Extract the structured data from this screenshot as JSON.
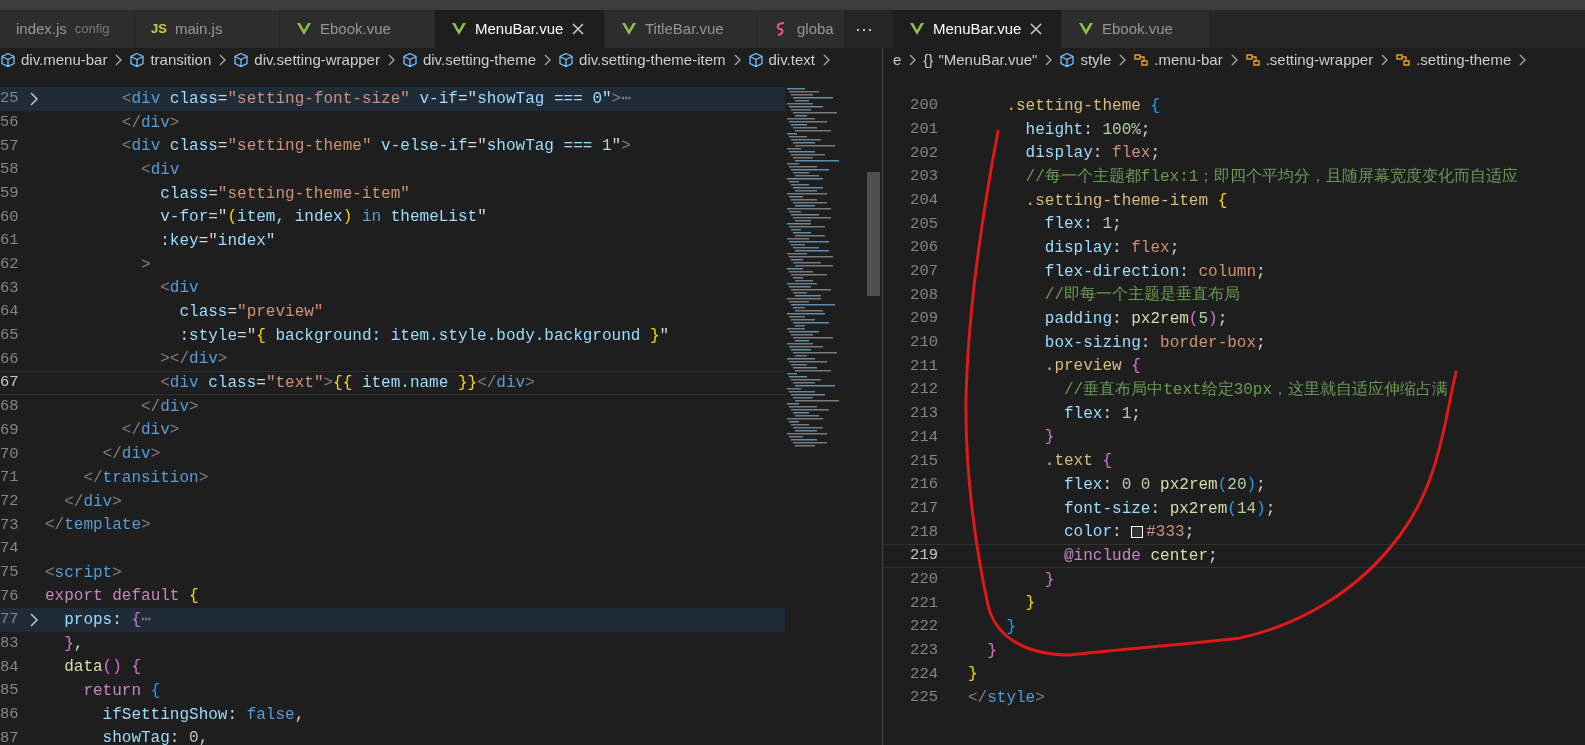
{
  "left_group": {
    "tabs": [
      {
        "label": "index.js",
        "description": "config",
        "kind": "plain",
        "selected": false
      },
      {
        "label": "main.js",
        "kind": "js",
        "badge": "JS",
        "selected": false
      },
      {
        "label": "Ebook.vue",
        "kind": "vue",
        "selected": false
      },
      {
        "label": "MenuBar.vue",
        "kind": "vue",
        "selected": true
      },
      {
        "label": "TitleBar.vue",
        "kind": "vue",
        "selected": false
      },
      {
        "label": "globa",
        "kind": "sass",
        "selected": false
      }
    ],
    "more_button": "⋯",
    "breadcrumbs": [
      {
        "label": "div.menu-bar",
        "kind": "element"
      },
      {
        "label": "transition",
        "kind": "element"
      },
      {
        "label": "div.setting-wrapper",
        "kind": "element"
      },
      {
        "label": "div.setting-theme",
        "kind": "element"
      },
      {
        "label": "div.setting-theme-item",
        "kind": "element"
      },
      {
        "label": "div.text",
        "kind": "element"
      }
    ],
    "lines": [
      {
        "n": "25",
        "kind": "markup",
        "folded": true,
        "current": false,
        "text": "        <div class=\"setting-font-size\" v-if=\"showTag === 0\">⋯"
      },
      {
        "n": "56",
        "kind": "markup",
        "folded": false,
        "current": false,
        "text": "        </div>"
      },
      {
        "n": "57",
        "kind": "markup",
        "folded": false,
        "current": false,
        "text": "        <div class=\"setting-theme\" v-else-if=\"showTag === 1\">"
      },
      {
        "n": "58",
        "kind": "markup",
        "folded": false,
        "current": false,
        "text": "          <div"
      },
      {
        "n": "59",
        "kind": "markup",
        "folded": false,
        "current": false,
        "text": "            class=\"setting-theme-item\""
      },
      {
        "n": "60",
        "kind": "markup",
        "folded": false,
        "current": false,
        "text": "            v-for=\"(item, index) in themeList\""
      },
      {
        "n": "61",
        "kind": "markup",
        "folded": false,
        "current": false,
        "text": "            :key=\"index\""
      },
      {
        "n": "62",
        "kind": "markup",
        "folded": false,
        "current": false,
        "text": "          >"
      },
      {
        "n": "63",
        "kind": "markup",
        "folded": false,
        "current": false,
        "text": "            <div"
      },
      {
        "n": "64",
        "kind": "markup",
        "folded": false,
        "current": false,
        "text": "              class=\"preview\""
      },
      {
        "n": "65",
        "kind": "markup",
        "folded": false,
        "current": false,
        "text": "              :style=\"{ background: item.style.body.background }\""
      },
      {
        "n": "66",
        "kind": "markup",
        "folded": false,
        "current": false,
        "text": "            ></div>"
      },
      {
        "n": "67",
        "kind": "markup",
        "folded": false,
        "current": true,
        "text": "            <div class=\"text\">{{ item.name }}</div>"
      },
      {
        "n": "68",
        "kind": "markup",
        "folded": false,
        "current": false,
        "text": "          </div>"
      },
      {
        "n": "69",
        "kind": "markup",
        "folded": false,
        "current": false,
        "text": "        </div>"
      },
      {
        "n": "70",
        "kind": "markup",
        "folded": false,
        "current": false,
        "text": "      </div>"
      },
      {
        "n": "71",
        "kind": "markup",
        "folded": false,
        "current": false,
        "text": "    </transition>"
      },
      {
        "n": "72",
        "kind": "markup",
        "folded": false,
        "current": false,
        "text": "  </div>"
      },
      {
        "n": "73",
        "kind": "markup",
        "folded": false,
        "current": false,
        "text": "</template>"
      },
      {
        "n": "74",
        "folded": false,
        "current": false
      },
      {
        "n": "75",
        "kind": "markup",
        "folded": false,
        "current": false,
        "text": "<script>"
      },
      {
        "n": "76",
        "kind": "script",
        "folded": false,
        "current": false,
        "text": "export default {"
      },
      {
        "n": "77",
        "kind": "script",
        "folded": true,
        "current": false,
        "text": "  props: {⋯"
      },
      {
        "n": "83",
        "kind": "script",
        "folded": false,
        "current": false,
        "text": "  },"
      },
      {
        "n": "84",
        "kind": "script",
        "folded": false,
        "current": false,
        "text": "  data() {"
      },
      {
        "n": "85",
        "kind": "script",
        "folded": false,
        "current": false,
        "text": "    return {"
      },
      {
        "n": "86",
        "kind": "script",
        "folded": false,
        "current": false,
        "text": "      ifSettingShow: false,"
      },
      {
        "n": "87",
        "kind": "script",
        "folded": false,
        "current": false,
        "text": "      showTag: 0,"
      }
    ]
  },
  "right_group": {
    "tabs": [
      {
        "label": "MenuBar.vue",
        "kind": "vue",
        "selected": true
      },
      {
        "label": "Ebook.vue",
        "kind": "vue",
        "selected": false
      }
    ],
    "breadcrumbs": [
      {
        "label": "e",
        "kind": "plain"
      },
      {
        "label": "\"MenuBar.vue\"",
        "kind": "braces",
        "badge": "{}"
      },
      {
        "label": "style",
        "kind": "element"
      },
      {
        "label": ".menu-bar",
        "kind": "class"
      },
      {
        "label": ".setting-wrapper",
        "kind": "class"
      },
      {
        "label": ".setting-theme",
        "kind": "class"
      }
    ],
    "lines": [
      {
        "n": "200",
        "kind": "style",
        "current": false,
        "text": "    .setting-theme {"
      },
      {
        "n": "201",
        "kind": "style",
        "current": false,
        "text": "      height: 100%;"
      },
      {
        "n": "202",
        "kind": "style",
        "current": false,
        "text": "      display: flex;"
      },
      {
        "n": "203",
        "kind": "style",
        "current": false,
        "text": "      //每一个主题都flex:1；即四个平均分，且随屏幕宽度变化而自适应"
      },
      {
        "n": "204",
        "kind": "style",
        "current": false,
        "text": "      .setting-theme-item {"
      },
      {
        "n": "205",
        "kind": "style",
        "current": false,
        "text": "        flex: 1;"
      },
      {
        "n": "206",
        "kind": "style",
        "current": false,
        "text": "        display: flex;"
      },
      {
        "n": "207",
        "kind": "style",
        "current": false,
        "text": "        flex-direction: column;"
      },
      {
        "n": "208",
        "kind": "style",
        "current": false,
        "text": "        //即每一个主题是垂直布局"
      },
      {
        "n": "209",
        "kind": "style",
        "current": false,
        "text": "        padding: px2rem(5);"
      },
      {
        "n": "210",
        "kind": "style",
        "current": false,
        "text": "        box-sizing: border-box;"
      },
      {
        "n": "211",
        "kind": "style",
        "current": false,
        "text": "        .preview {"
      },
      {
        "n": "212",
        "kind": "style",
        "current": false,
        "text": "          //垂直布局中text给定30px，这里就自适应伸缩占满"
      },
      {
        "n": "213",
        "kind": "style",
        "current": false,
        "text": "          flex: 1;"
      },
      {
        "n": "214",
        "kind": "style",
        "current": false,
        "text": "        }"
      },
      {
        "n": "215",
        "kind": "style",
        "current": false,
        "text": "        .text {"
      },
      {
        "n": "216",
        "kind": "style",
        "current": false,
        "text": "          flex: 0 0 px2rem(20);"
      },
      {
        "n": "217",
        "kind": "style",
        "current": false,
        "text": "          font-size: px2rem(14);"
      },
      {
        "n": "218",
        "kind": "style",
        "current": false,
        "text": "          color: #333;"
      },
      {
        "n": "219",
        "kind": "style",
        "current": true,
        "text": "          @include center;"
      },
      {
        "n": "220",
        "kind": "style",
        "current": false,
        "text": "        }"
      },
      {
        "n": "221",
        "kind": "style",
        "current": false,
        "text": "      }"
      },
      {
        "n": "222",
        "kind": "style",
        "current": false,
        "text": "    }"
      },
      {
        "n": "223",
        "kind": "style",
        "current": false,
        "text": "  }"
      },
      {
        "n": "224",
        "kind": "style",
        "current": false,
        "text": "}"
      },
      {
        "n": "225",
        "kind": "markup",
        "current": false,
        "text": "</style>"
      }
    ]
  }
}
